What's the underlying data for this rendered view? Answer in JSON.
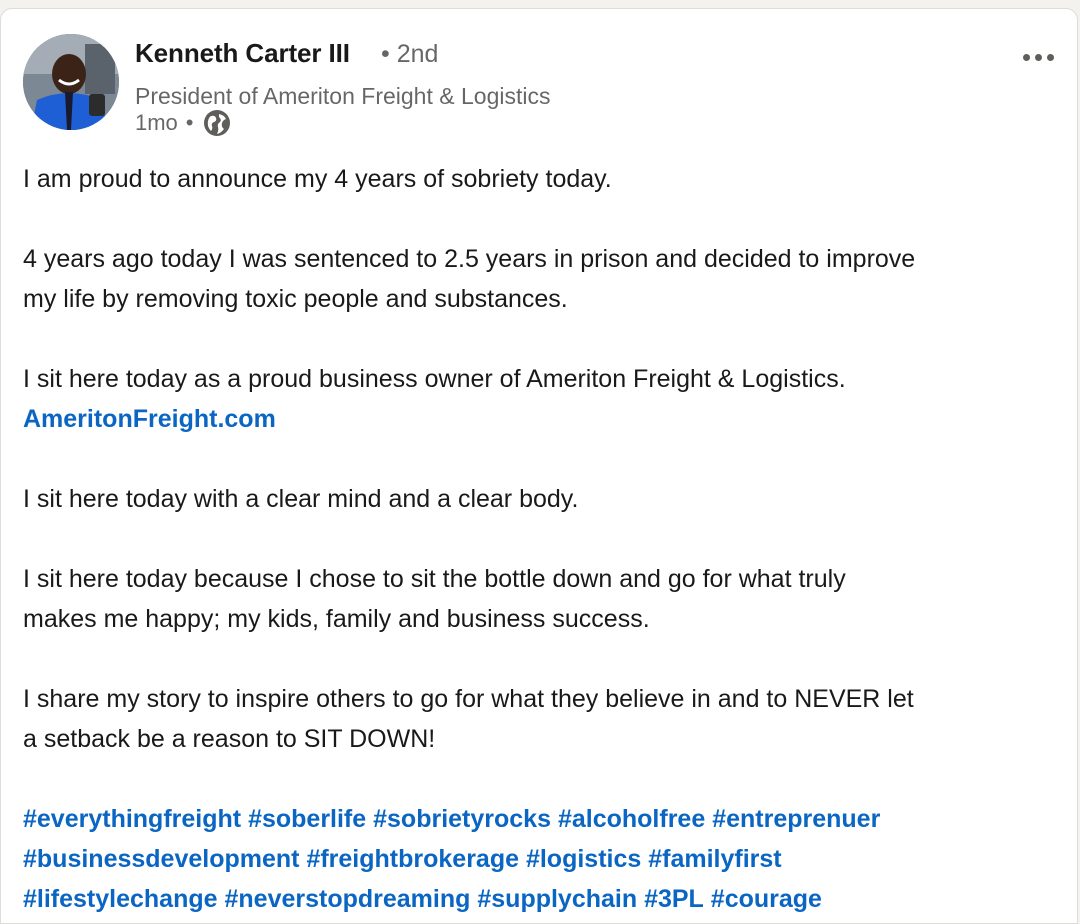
{
  "post": {
    "author": {
      "name": "Kenneth Carter III",
      "degree": "2nd",
      "headline": "President of Ameriton Freight & Logistics",
      "time": "1mo",
      "visibility_icon": "globe-icon"
    },
    "more_icon": "ellipsis-icon",
    "paragraphs": [
      "I am proud to announce my 4 years of sobriety today.",
      "4 years ago today I was sentenced to 2.5 years in prison and decided to improve",
      "my life by removing toxic people and substances.",
      "I sit here today as a proud business owner of Ameriton Freight & Logistics.",
      "I sit here today with a clear mind and a clear body.",
      "I sit here today because I chose to sit the bottle down and go for what truly",
      "makes me happy; my kids, family and business success.",
      "I share my story to inspire others to go for what they believe in and to NEVER let",
      "a setback be a reason to SIT DOWN!"
    ],
    "website_link": "AmeritonFreight.com",
    "hashtags": [
      "#everythingfreight",
      "#soberlife",
      "#sobrietyrocks",
      "#alcoholfree",
      "#entreprenuer",
      "#businessdevelopment",
      "#freightbrokerage",
      "#logistics",
      "#familyfirst",
      "#lifestylechange",
      "#neverstopdreaming",
      "#supplychain",
      "#3PL",
      "#courage"
    ]
  },
  "colors": {
    "link": "#0a66c2",
    "text": "#191919",
    "muted": "#666666",
    "page_background": "#f3f2ef",
    "card_background": "#ffffff"
  }
}
